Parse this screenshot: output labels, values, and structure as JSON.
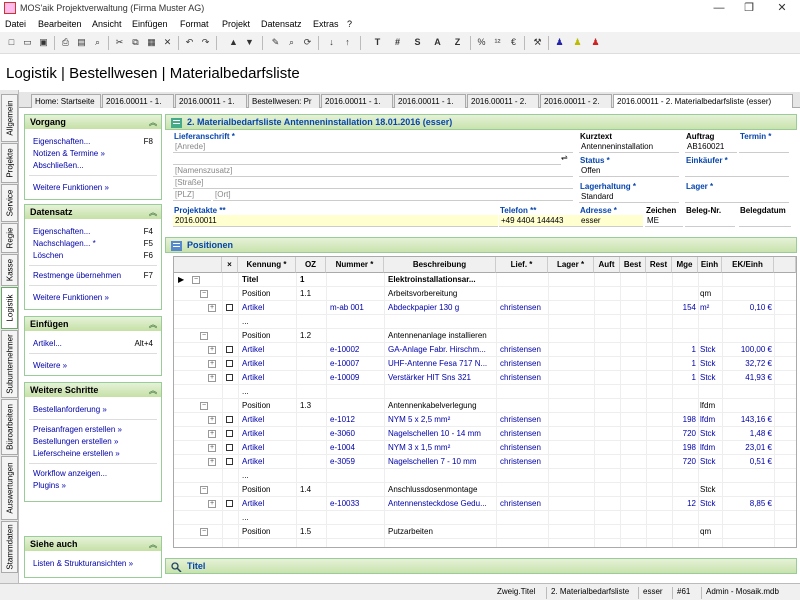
{
  "window": {
    "title": "MOS'aik Projektverwaltung (Firma Muster AG)",
    "minimize": "—",
    "maximize": "❐",
    "close": "✕"
  },
  "menu": [
    "Datei",
    "Bearbeiten",
    "Ansicht",
    "Einfügen",
    "Format",
    "Projekt",
    "Datensatz",
    "Extras",
    "?"
  ],
  "toolbar": {
    "text_buttons": [
      "T",
      "#",
      "S",
      "A",
      "Z"
    ]
  },
  "header": {
    "title": "Logistik | Bestellwesen | Materialbedarfsliste"
  },
  "vtabs": [
    "Allgemein",
    "Projekte",
    "Service",
    "Regie",
    "Kasse",
    "Logistik",
    "Subunternehmer",
    "Büroarbeiten",
    "Auswertungen",
    "Stammdaten"
  ],
  "tabs": [
    "Home: Startseite",
    "2016.00011 - 1.",
    "2016.00011 - 1.",
    "Bestellwesen: Pr",
    "2016.00011 - 1.",
    "2016.00011 - 1.",
    "2016.00011 - 2.",
    "2016.00011 - 2.",
    "2016.00011 - 2. Materialbedarfsliste (esser)"
  ],
  "sidebar": {
    "vorgang": {
      "title": "Vorgang",
      "items": [
        {
          "label": "Eigenschaften...",
          "key": "F8"
        },
        {
          "label": "Notizen & Termine »"
        },
        {
          "label": "Abschließen..."
        },
        {
          "label": "Weitere Funktionen »"
        }
      ]
    },
    "datensatz": {
      "title": "Datensatz",
      "items": [
        {
          "label": "Eigenschaften...",
          "key": "F4"
        },
        {
          "label": "Nachschlagen... *",
          "key": "F5"
        },
        {
          "label": "Löschen",
          "key": "F6"
        },
        {
          "label": "Restmenge übernehmen",
          "key": "F7"
        },
        {
          "label": "Weitere Funktionen »"
        }
      ]
    },
    "einfuegen": {
      "title": "Einfügen",
      "items": [
        {
          "label": "Artikel...",
          "key": "Alt+4"
        },
        {
          "label": "Weitere »"
        }
      ]
    },
    "schritte": {
      "title": "Weitere Schritte",
      "items": [
        {
          "label": "Bestellanforderung »"
        },
        {
          "label": "Preisanfragen erstellen »"
        },
        {
          "label": "Bestellungen erstellen »"
        },
        {
          "label": "Lieferscheine erstellen »"
        },
        {
          "label": "Workflow anzeigen..."
        },
        {
          "label": "Plugins »"
        }
      ]
    },
    "siehe": {
      "title": "Siehe auch",
      "items": [
        {
          "label": "Listen & Strukturansichten »"
        }
      ]
    }
  },
  "form": {
    "panel_title": "2. Materialbedarfsliste Antenneninstallation 18.01.2016 (esser)",
    "lieferanschrift_label": "Lieferanschrift *",
    "anrede": "[Anrede]",
    "namenszusatz": "[Namenszusatz]",
    "strasse": "[Straße]",
    "plz": "[PLZ]",
    "ort": "[Ort]",
    "kurztext_label": "Kurztext",
    "kurztext": "Antenneninstallation",
    "auftrag_label": "Auftrag",
    "auftrag": "AB160021",
    "termin_label": "Termin *",
    "status_label": "Status *",
    "status": "Offen",
    "einkaeufer_label": "Einkäufer *",
    "lagerhaltung_label": "Lagerhaltung *",
    "lagerhaltung": "Standard",
    "lager_label": "Lager *",
    "projektakte_label": "Projektakte **",
    "projektakte": "2016.00011",
    "telefon_label": "Telefon **",
    "telefon": "+49 4404 144443",
    "adresse_label": "Adresse *",
    "adresse": "esser",
    "zeichen_label": "Zeichen",
    "zeichen": "ME",
    "belegnr_label": "Beleg-Nr.",
    "belegdatum_label": "Belegdatum"
  },
  "positions": {
    "title": "Positionen",
    "columns": [
      "×",
      "Kennung *",
      "OZ",
      "Nummer *",
      "Beschreibung",
      "Lief. *",
      "Lager *",
      "Auft",
      "Best",
      "Rest",
      "Mge",
      "Einh",
      "EK/Einh"
    ],
    "rows": [
      {
        "kennung": "Titel",
        "oz": "1",
        "nummer": "",
        "beschr": "Elektroinstallationsar...",
        "lief": "",
        "mge": "",
        "einh": "",
        "ek": "",
        "type": "titel"
      },
      {
        "kennung": "Position",
        "oz": "1.1",
        "nummer": "",
        "beschr": "Arbeitsvorbereitung",
        "lief": "",
        "mge": "",
        "einh": "qm",
        "ek": "",
        "type": "pos"
      },
      {
        "kennung": "Artikel",
        "oz": "",
        "nummer": "m-ab 001",
        "beschr": "Abdeckpapier 130 g",
        "lief": "christensen",
        "mge": "154",
        "einh": "m²",
        "ek": "0,10 €",
        "type": "art"
      },
      {
        "kennung": "...",
        "oz": "",
        "nummer": "",
        "beschr": "",
        "lief": "",
        "mge": "",
        "einh": "",
        "ek": "",
        "type": "dots"
      },
      {
        "kennung": "Position",
        "oz": "1.2",
        "nummer": "",
        "beschr": "Antennenanlage installieren",
        "lief": "",
        "mge": "",
        "einh": "",
        "ek": "",
        "type": "pos"
      },
      {
        "kennung": "Artikel",
        "oz": "",
        "nummer": "e-10002",
        "beschr": "GA-Anlage Fabr. Hirschm...",
        "lief": "christensen",
        "mge": "1",
        "einh": "Stck",
        "ek": "100,00 €",
        "type": "art"
      },
      {
        "kennung": "Artikel",
        "oz": "",
        "nummer": "e-10007",
        "beschr": "UHF-Antenne Fesa 717 N...",
        "lief": "christensen",
        "mge": "1",
        "einh": "Stck",
        "ek": "32,72 €",
        "type": "art"
      },
      {
        "kennung": "Artikel",
        "oz": "",
        "nummer": "e-10009",
        "beschr": "Verstärker HIT Sns 321",
        "lief": "christensen",
        "mge": "1",
        "einh": "Stck",
        "ek": "41,93 €",
        "type": "art"
      },
      {
        "kennung": "...",
        "oz": "",
        "nummer": "",
        "beschr": "",
        "lief": "",
        "mge": "",
        "einh": "",
        "ek": "",
        "type": "dots"
      },
      {
        "kennung": "Position",
        "oz": "1.3",
        "nummer": "",
        "beschr": "Antennenkabelverlegung",
        "lief": "",
        "mge": "",
        "einh": "lfdm",
        "ek": "",
        "type": "pos"
      },
      {
        "kennung": "Artikel",
        "oz": "",
        "nummer": "e-1012",
        "beschr": "NYM 5 x 2,5 mm²",
        "lief": "christensen",
        "mge": "198",
        "einh": "lfdm",
        "ek": "143,16 €",
        "type": "art"
      },
      {
        "kennung": "Artikel",
        "oz": "",
        "nummer": "e-3060",
        "beschr": "Nagelschellen 10 - 14 mm",
        "lief": "christensen",
        "mge": "720",
        "einh": "Stck",
        "ek": "1,48 €",
        "type": "art"
      },
      {
        "kennung": "Artikel",
        "oz": "",
        "nummer": "e-1004",
        "beschr": "NYM 3 x 1,5 mm²",
        "lief": "christensen",
        "mge": "198",
        "einh": "lfdm",
        "ek": "23,01 €",
        "type": "art"
      },
      {
        "kennung": "Artikel",
        "oz": "",
        "nummer": "e-3059",
        "beschr": "Nagelschellen 7 - 10 mm",
        "lief": "christensen",
        "mge": "720",
        "einh": "Stck",
        "ek": "0,51 €",
        "type": "art"
      },
      {
        "kennung": "...",
        "oz": "",
        "nummer": "",
        "beschr": "",
        "lief": "",
        "mge": "",
        "einh": "",
        "ek": "",
        "type": "dots"
      },
      {
        "kennung": "Position",
        "oz": "1.4",
        "nummer": "",
        "beschr": "Anschlussdosenmontage",
        "lief": "",
        "mge": "",
        "einh": "Stck",
        "ek": "",
        "type": "pos"
      },
      {
        "kennung": "Artikel",
        "oz": "",
        "nummer": "e-10033",
        "beschr": "Antennensteckdose Gedu...",
        "lief": "christensen",
        "mge": "12",
        "einh": "Stck",
        "ek": "8,85 €",
        "type": "art"
      },
      {
        "kennung": "...",
        "oz": "",
        "nummer": "",
        "beschr": "",
        "lief": "",
        "mge": "",
        "einh": "",
        "ek": "",
        "type": "dots"
      },
      {
        "kennung": "Position",
        "oz": "1.5",
        "nummer": "",
        "beschr": "Putzarbeiten",
        "lief": "",
        "mge": "",
        "einh": "qm",
        "ek": "",
        "type": "pos"
      }
    ]
  },
  "titel_panel": {
    "title": "Titel"
  },
  "statusbar": [
    "Zweig.Titel",
    "2. Materialbedarfsliste",
    "esser",
    "#61",
    "Admin - Mosaik.mdb"
  ],
  "colors": {
    "accent_green": "#c5e0a5",
    "link_blue": "#0645ad",
    "yellow_field": "#ffffd0"
  }
}
